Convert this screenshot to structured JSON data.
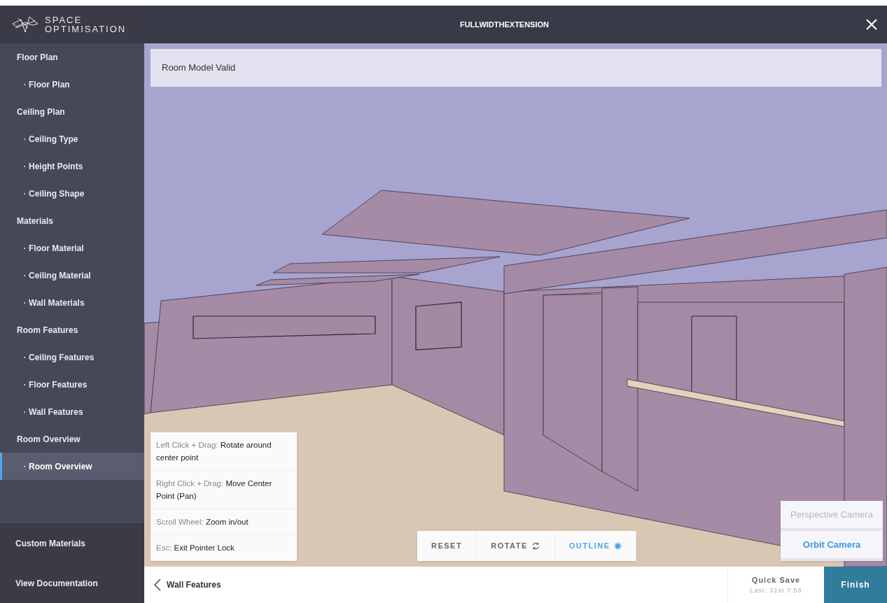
{
  "brand": {
    "line1": "SPACE",
    "line2": "OPTIMISATION"
  },
  "header": {
    "title": "FULLWIDTHEXTENSION"
  },
  "sidebar": {
    "sections": [
      {
        "label": "Floor Plan",
        "children": [
          {
            "label": "Floor Plan",
            "selected": false
          }
        ]
      },
      {
        "label": "Ceiling Plan",
        "children": [
          {
            "label": "Ceiling Type",
            "selected": false
          },
          {
            "label": "Height Points",
            "selected": false
          },
          {
            "label": "Ceiling Shape",
            "selected": false
          }
        ]
      },
      {
        "label": "Materials",
        "children": [
          {
            "label": "Floor Material",
            "selected": false
          },
          {
            "label": "Ceiling Material",
            "selected": false
          },
          {
            "label": "Wall Materials",
            "selected": false
          }
        ]
      },
      {
        "label": "Room Features",
        "children": [
          {
            "label": "Ceiling Features",
            "selected": false
          },
          {
            "label": "Floor Features",
            "selected": false
          },
          {
            "label": "Wall Features",
            "selected": false
          }
        ]
      },
      {
        "label": "Room Overview",
        "children": [
          {
            "label": "Room Overview",
            "selected": true
          }
        ]
      }
    ],
    "footer_links": [
      "Custom Materials",
      "View Documentation"
    ]
  },
  "status_banner": "Room Model Valid",
  "control_hints": [
    {
      "key": "Left Click + Drag:",
      "action": "Rotate around center point"
    },
    {
      "key": "Right Click + Drag:",
      "action": "Move Center Point (Pan)"
    },
    {
      "key": "Scroll Wheel:",
      "action": "Zoom in/out"
    },
    {
      "key": "Esc:",
      "action": "Exit Pointer Lock"
    }
  ],
  "toolbar": [
    {
      "label": "RESET",
      "kind": "plain"
    },
    {
      "label": "ROTATE",
      "kind": "rotate"
    },
    {
      "label": "OUTLINE",
      "kind": "toggle",
      "on": true
    }
  ],
  "cameras": [
    {
      "label": "Perspective Camera",
      "selected": false
    },
    {
      "label": "Orbit Camera",
      "selected": true
    }
  ],
  "footer": {
    "back_label": "Wall Features",
    "quick_save": "Quick Save",
    "last_saved": "Last: 31st 7:58",
    "finish": "Finish"
  }
}
